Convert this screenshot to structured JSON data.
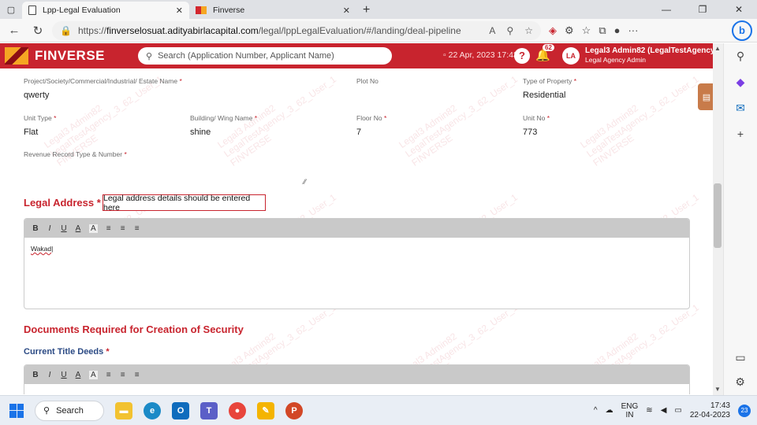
{
  "browser": {
    "tabs": [
      {
        "title": "Lpp-Legal Evaluation",
        "active": true
      },
      {
        "title": "Finverse",
        "active": false
      }
    ],
    "url_prefix": "https://",
    "url_host": "finverselosuat.adityabirlacapital.com",
    "url_path": "/legal/lppLegalEvaluation/#/landing/deal-pipeline",
    "ext_badge": "62"
  },
  "header": {
    "brand": "FINVERSE",
    "search_placeholder": "Search (Application Number, Applicant Name)",
    "date": "22 Apr, 2023 17:43",
    "notif_count": "62",
    "avatar": "LA",
    "user_name": "Legal3 Admin82 (LegalTestAgency_3_6",
    "user_role": "Legal Agency Admin",
    "accent": "#c8242e"
  },
  "form": {
    "project_label": "Project/Society/Commercial/Industrial/ Estate Name",
    "project_value": "qwerty",
    "plot_label": "Plot No",
    "plot_value": "",
    "property_type_label": "Type of Property",
    "property_type_value": "Residential",
    "unit_type_label": "Unit Type",
    "unit_type_value": "Flat",
    "building_label": "Building/ Wing Name",
    "building_value": "shine",
    "floor_label": "Floor No",
    "floor_value": "7",
    "unit_no_label": "Unit No",
    "unit_no_value": "773",
    "revenue_label": "Revenue Record Type & Number",
    "revenue_value": "",
    "required_mark": "*"
  },
  "legal_address": {
    "title": "Legal Address",
    "callout": "Legal address details should be entered here",
    "content": "Wakad",
    "toolbar": [
      "B",
      "I",
      "U",
      "A",
      "A",
      "≡",
      "≡",
      "≡"
    ]
  },
  "documents": {
    "title": "Documents Required for Creation of Security",
    "current_title_deeds_label": "Current Title Deeds",
    "toolbar": [
      "B",
      "I",
      "U",
      "A",
      "A",
      "≡",
      "≡",
      "≡"
    ]
  },
  "watermark": {
    "line1": "Legal3 Admin82",
    "line2": "LegalTestAgency_3_62_User_1",
    "line3": "FINVERSE"
  },
  "taskbar": {
    "search_label": "Search",
    "lang_top": "ENG",
    "lang_bottom": "IN",
    "time": "17:43",
    "date": "22-04-2023",
    "notif_count": "23"
  }
}
